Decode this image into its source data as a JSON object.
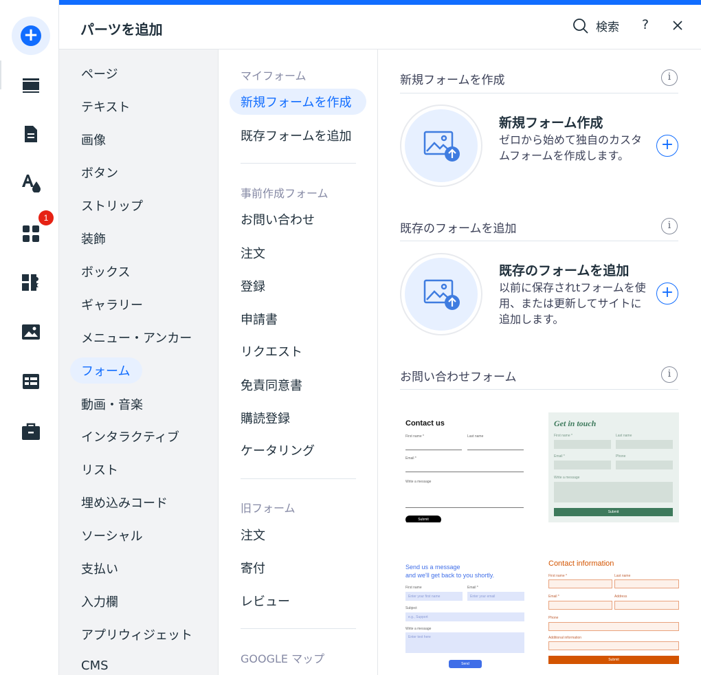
{
  "rail": {
    "badge_count": "1",
    "accent_color": "#116dff",
    "items": [
      {
        "name": "add-elements",
        "icon": "plus-circle-icon",
        "active": true
      },
      {
        "name": "pages",
        "icon": "pages-icon"
      },
      {
        "name": "blog",
        "icon": "document-icon"
      },
      {
        "name": "design",
        "icon": "theme-icon"
      },
      {
        "name": "apps",
        "icon": "apps-grid-icon"
      },
      {
        "name": "business",
        "icon": "puzzle-icon"
      },
      {
        "name": "media",
        "icon": "image-icon"
      },
      {
        "name": "cms",
        "icon": "table-icon"
      },
      {
        "name": "portfolio",
        "icon": "briefcase-icon"
      }
    ]
  },
  "header": {
    "title": "パーツを追加",
    "search_label": "検索",
    "help_label": "?"
  },
  "categories": [
    "ページ",
    "テキスト",
    "画像",
    "ボタン",
    "ストリップ",
    "装飾",
    "ボックス",
    "ギャラリー",
    "メニュー・アンカー",
    "フォーム",
    "動画・音楽",
    "インタラクティブ",
    "リスト",
    "埋め込みコード",
    "ソーシャル",
    "支払い",
    "入力欄",
    "アプリウィジェット",
    "CMS"
  ],
  "selected_category": "フォーム",
  "subpanel": {
    "my_forms_heading": "マイフォーム",
    "my_forms": [
      "新規フォームを作成",
      "既存フォームを追加"
    ],
    "premade_heading": "事前作成フォーム",
    "premade": [
      "お問い合わせ",
      "注文",
      "登録",
      "申請書",
      "リクエスト",
      "免責同意書",
      "購読登録",
      "ケータリング"
    ],
    "legacy_heading": "旧フォーム",
    "legacy": [
      "注文",
      "寄付",
      "レビュー"
    ],
    "google_heading": "GOOGLE マップ"
  },
  "content": {
    "new_form": {
      "section_title": "新規フォームを作成",
      "card_title": "新規フォーム作成",
      "card_desc": "ゼロから始めて独自のカスタムフォームを作成します。"
    },
    "existing_form": {
      "section_title": "既存のフォームを追加",
      "card_title": "既存のフォームを追加",
      "card_desc": "以前に保存されtフォームを使用、または更新してサイトに追加します。"
    },
    "contact_section_title": "お問い合わせフォーム",
    "templates": {
      "t1": {
        "title": "Contact us",
        "first": "First name *",
        "last": "Last name",
        "email": "Email *",
        "message": "Write a message",
        "submit": "Submit"
      },
      "t2": {
        "title": "Get in touch",
        "first": "First name *",
        "last": "Last name",
        "email": "Email *",
        "phone": "Phone",
        "message": "Write a message",
        "submit": "Submit"
      },
      "t3": {
        "title_line1": "Send us a message",
        "title_line2": "and we'll get back to you shortly.",
        "first": "First name",
        "email": "Email *",
        "first_ph": "Enter your first name",
        "email_ph": "Enter your email",
        "subject": "Subject",
        "subject_ph": "e.g., Support",
        "message": "Write a message",
        "message_ph": "Enter text here",
        "submit": "Send"
      },
      "t4": {
        "title": "Contact information",
        "first": "First name *",
        "last": "Last name",
        "email": "Email *",
        "address": "Address",
        "phone": "Phone",
        "additional": "Additional information",
        "submit": "Submit"
      }
    }
  }
}
